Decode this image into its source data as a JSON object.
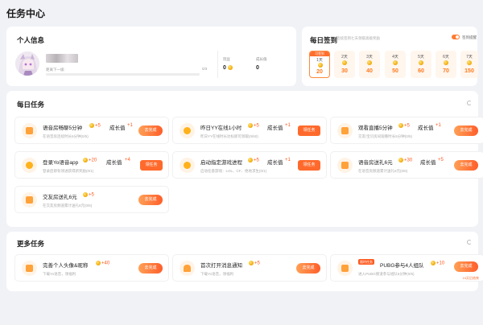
{
  "page_title": "任务中心",
  "profile": {
    "title": "个人信息",
    "level_text": "距离下一级:",
    "progress": "0/3",
    "progress_fraction": 0,
    "stats": [
      {
        "label": "玩豆",
        "value": "0"
      },
      {
        "label": "成长值",
        "value": "0"
      }
    ]
  },
  "checkin": {
    "title": "每日签到",
    "subtitle": "连续签到七天领取高级奖励",
    "toggle_label": "签到提醒",
    "today_badge": "可签到",
    "days": [
      {
        "label": "1天",
        "value": "20"
      },
      {
        "label": "2天",
        "value": "30"
      },
      {
        "label": "3天",
        "value": "40"
      },
      {
        "label": "4天",
        "value": "50"
      },
      {
        "label": "5天",
        "value": "60"
      },
      {
        "label": "6天",
        "value": "70"
      },
      {
        "label": "7天",
        "value": "150"
      }
    ]
  },
  "daily": {
    "title": "每日任务",
    "tasks": [
      {
        "name": "语音房畅聊5分钟",
        "desc": "在语音房连续时长5分钟(0/5)",
        "coins": "+5",
        "grow_label": "成长值",
        "grow": "+1",
        "button": "去完成"
      },
      {
        "name": "昨日YY在线1小时",
        "desc": "昨日YY在线时长达标即可领取(0/60)",
        "coins": "+5",
        "grow_label": "成长值",
        "grow": "+1",
        "button": "领任务"
      },
      {
        "name": "观看直播5分钟",
        "desc": "交友/宝贝房间观看时长5分钟(0/5)",
        "coins": "+5",
        "grow_label": "成长值",
        "grow": "+1",
        "button": "去完成"
      },
      {
        "name": "登录Yo语音app",
        "desc": "登录后即有领进获得新奖励(0/1)",
        "coins": "+20",
        "grow_label": "成长值",
        "grow": "+4",
        "button": "领任务"
      },
      {
        "name": "启动指定游戏进程",
        "desc": "启动任意游戏：LOL、CF、绝地求生(0/1)",
        "coins": "+5",
        "grow_label": "成长值",
        "grow": "+1",
        "button": "领任务"
      },
      {
        "name": "语音房送礼6元",
        "desc": "在语音房频道累计送礼6元(0/6)",
        "coins": "+30",
        "grow_label": "成长值",
        "grow": "+5",
        "button": "去完成"
      },
      {
        "name": "交友房送礼6元",
        "desc": "在交友房频道累计送礼6元(0/6)",
        "coins": "+5",
        "button": "去完成"
      }
    ]
  },
  "more": {
    "title": "更多任务",
    "tasks": [
      {
        "name": "完善个人头像&昵称",
        "desc": "下载Yo语音，领福利",
        "coins": "+40",
        "button": "去完成"
      },
      {
        "name": "首次打开消息通知",
        "desc": "下载Yo语音，领福利",
        "coins": "+5",
        "button": "去完成"
      },
      {
        "name": "PUBG参与4人组队",
        "tag": "限时任务",
        "desc": "进入PUBG频道参与组队5分钟(0/5)",
        "coins": "+10",
        "button": "去完成",
        "note": "10天后结束"
      }
    ]
  },
  "colors": {
    "accent": "#ff6a2c",
    "coin": "#f3b011"
  }
}
